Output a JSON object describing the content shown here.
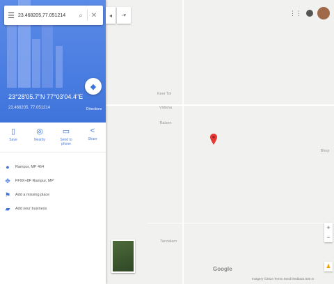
{
  "search": {
    "value": "23.468205,77.051214",
    "menu_icon": "menu-icon",
    "search_icon": "search-icon",
    "close_icon": "close-icon"
  },
  "colors": {
    "panel_header": "#3f74db",
    "pin": "#e53935",
    "text_muted": "#999999"
  },
  "place": {
    "coordinates": "23°28'05.7\"N 77°03'04.4\"E",
    "subtitle": "23.468205, 77.051214",
    "directions_label": "Directions"
  },
  "actions": [
    {
      "icon": "bookmark-icon",
      "label": "Save"
    },
    {
      "icon": "nearby-icon",
      "label": "Nearby"
    },
    {
      "icon": "phone-icon",
      "label": "Send to phone"
    },
    {
      "icon": "share-icon",
      "label": "Share"
    }
  ],
  "details": [
    {
      "icon": "location-pin-icon",
      "text": "Rampur, MP 464"
    },
    {
      "icon": "plus-code-icon",
      "text": "FF9X+8F Rampur, MP"
    },
    {
      "icon": "add-place-icon",
      "text": "Add a missing place"
    },
    {
      "icon": "flag-icon",
      "text": "Add your business"
    }
  ],
  "map": {
    "labels": [
      {
        "id": "label-village-1",
        "text": "Keer Tol"
      },
      {
        "id": "label-village-2",
        "text": "Vidisha"
      },
      {
        "id": "label-village-3",
        "text": "Raisen"
      },
      {
        "id": "label-village-4",
        "text": "Tarvtalam"
      },
      {
        "id": "label-edge",
        "text": "Bhop"
      }
    ],
    "google_logo": "Google",
    "footer": "Imagery ©2024 Terms Send feedback 500 m"
  }
}
